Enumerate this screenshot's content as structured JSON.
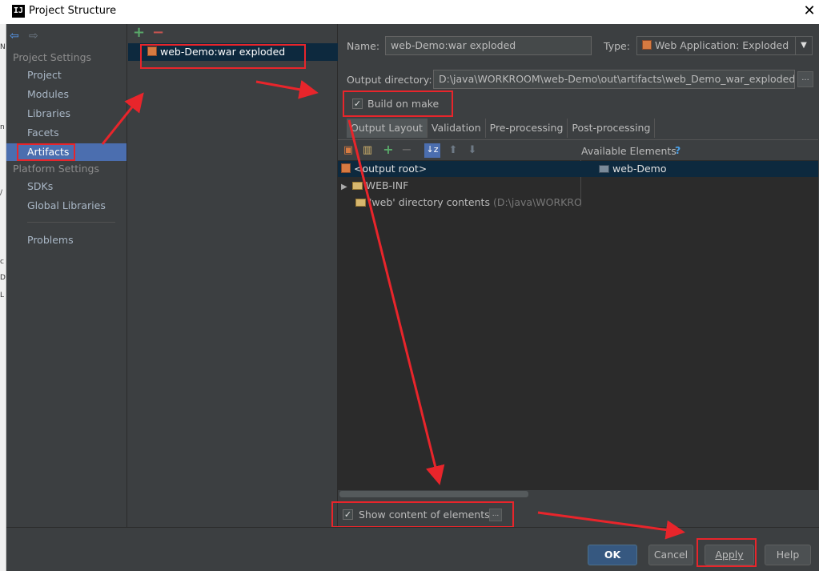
{
  "window": {
    "title": "Project Structure",
    "app_icon": "IJ"
  },
  "left_strip_chars": [
    "N",
    "n",
    "/",
    "c",
    "D",
    "L"
  ],
  "sidebar": {
    "project_settings_label": "Project Settings",
    "project_items": [
      "Project",
      "Modules",
      "Libraries",
      "Facets",
      "Artifacts"
    ],
    "selected": "Artifacts",
    "platform_settings_label": "Platform Settings",
    "platform_items": [
      "SDKs",
      "Global Libraries"
    ],
    "problems": "Problems"
  },
  "artifacts_list": {
    "items": [
      "web-Demo:war exploded"
    ]
  },
  "detail": {
    "name_label": "Name:",
    "name_value": "web-Demo:war exploded",
    "type_label": "Type:",
    "type_value": "Web Application: Exploded",
    "output_dir_label": "Output directory:",
    "output_dir_value": "D:\\java\\WORKROOM\\web-Demo\\out\\artifacts\\web_Demo_war_exploded",
    "browse_label": "...",
    "build_on_make_label": "Build on make",
    "build_on_make_checked": true,
    "tabs": [
      "Output Layout",
      "Validation",
      "Pre-processing",
      "Post-processing"
    ],
    "active_tab": "Output Layout",
    "available_elements_label": "Available Elements",
    "help_mark": "?",
    "tree": [
      {
        "label": "<output root>",
        "extra": ""
      },
      {
        "label": "WEB-INF",
        "extra": ""
      },
      {
        "label": "'web' directory contents",
        "extra": "(D:\\java\\WORKROOI"
      }
    ],
    "available_items": [
      "web-Demo"
    ],
    "show_content_label": "Show content of elements",
    "show_content_checked": true,
    "show_content_more": "..."
  },
  "buttons": {
    "ok": "OK",
    "cancel": "Cancel",
    "apply": "Apply",
    "help": "Help"
  },
  "colors": {
    "annotation_red": "#e8252b",
    "selection_blue": "#4b6eaf",
    "ok_blue": "#365880"
  }
}
